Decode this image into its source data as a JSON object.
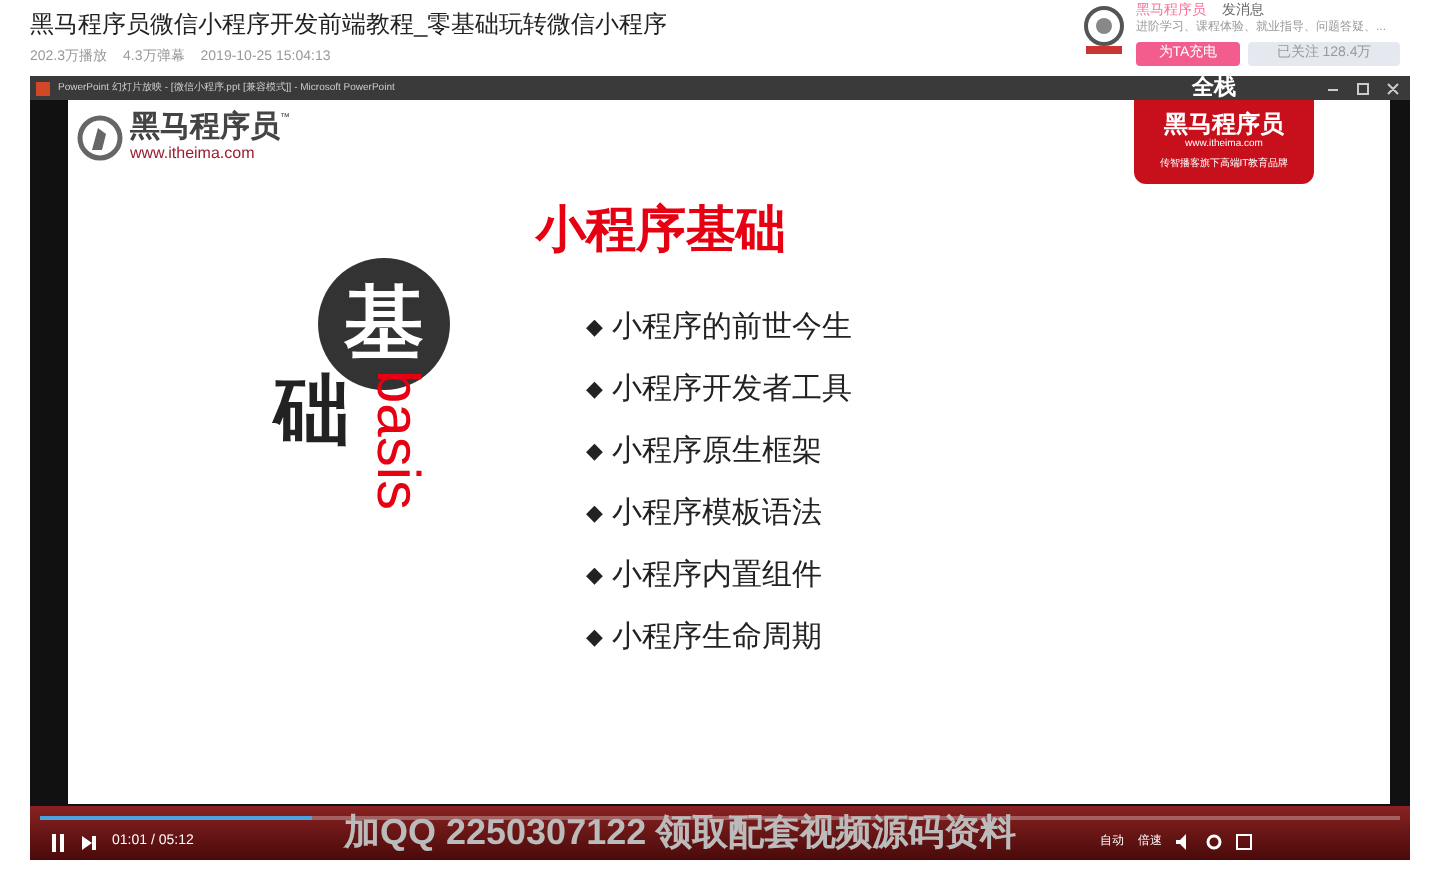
{
  "video": {
    "title": "黑马程序员微信小程序开发前端教程_零基础玩转微信小程序",
    "views": "202.3万播放",
    "danmaku": "4.3万弹幕",
    "date": "2019-10-25 15:04:13"
  },
  "uploader": {
    "name": "黑马程序员",
    "message": "发消息",
    "bio": "进阶学习、课程体验、就业指导、问题答疑、...",
    "charge_button": "为TA充电",
    "follow_button": "已关注 128.4万",
    "followed": true
  },
  "ppt_window": {
    "title": "PowerPoint 幻灯片放映 - [微信小程序.ppt [兼容模式]] - Microsoft PowerPoint",
    "overlay_text": "全栈"
  },
  "slide": {
    "logo_name": "黑马程序员",
    "logo_tm": "™",
    "logo_url": "www.itheima.com",
    "badge_name": "黑马程序员",
    "badge_url": "www.itheima.com",
    "badge_tagline": "传智播客旗下高端IT教育品牌",
    "title": "小程序基础",
    "big_char": "基",
    "second_char": "础",
    "rotated_word": "basis",
    "bullets": [
      {
        "marker": "◆",
        "text": "小程序的前世今生"
      },
      {
        "marker": "◆",
        "text": "小程序开发者工具"
      },
      {
        "marker": "◆",
        "text": "小程序原生框架"
      },
      {
        "marker": "◆",
        "text": "小程序模板语法"
      },
      {
        "marker": "◆",
        "text": "小程序内置组件"
      },
      {
        "marker": "◆",
        "text": "小程序生命周期"
      }
    ]
  },
  "player": {
    "playing": true,
    "level": 0.2,
    "time": "01:01 / 05:12",
    "banner": "加QQ 2250307122 领取配套视频源码资料",
    "auto": "自动",
    "speed": "倍速"
  }
}
